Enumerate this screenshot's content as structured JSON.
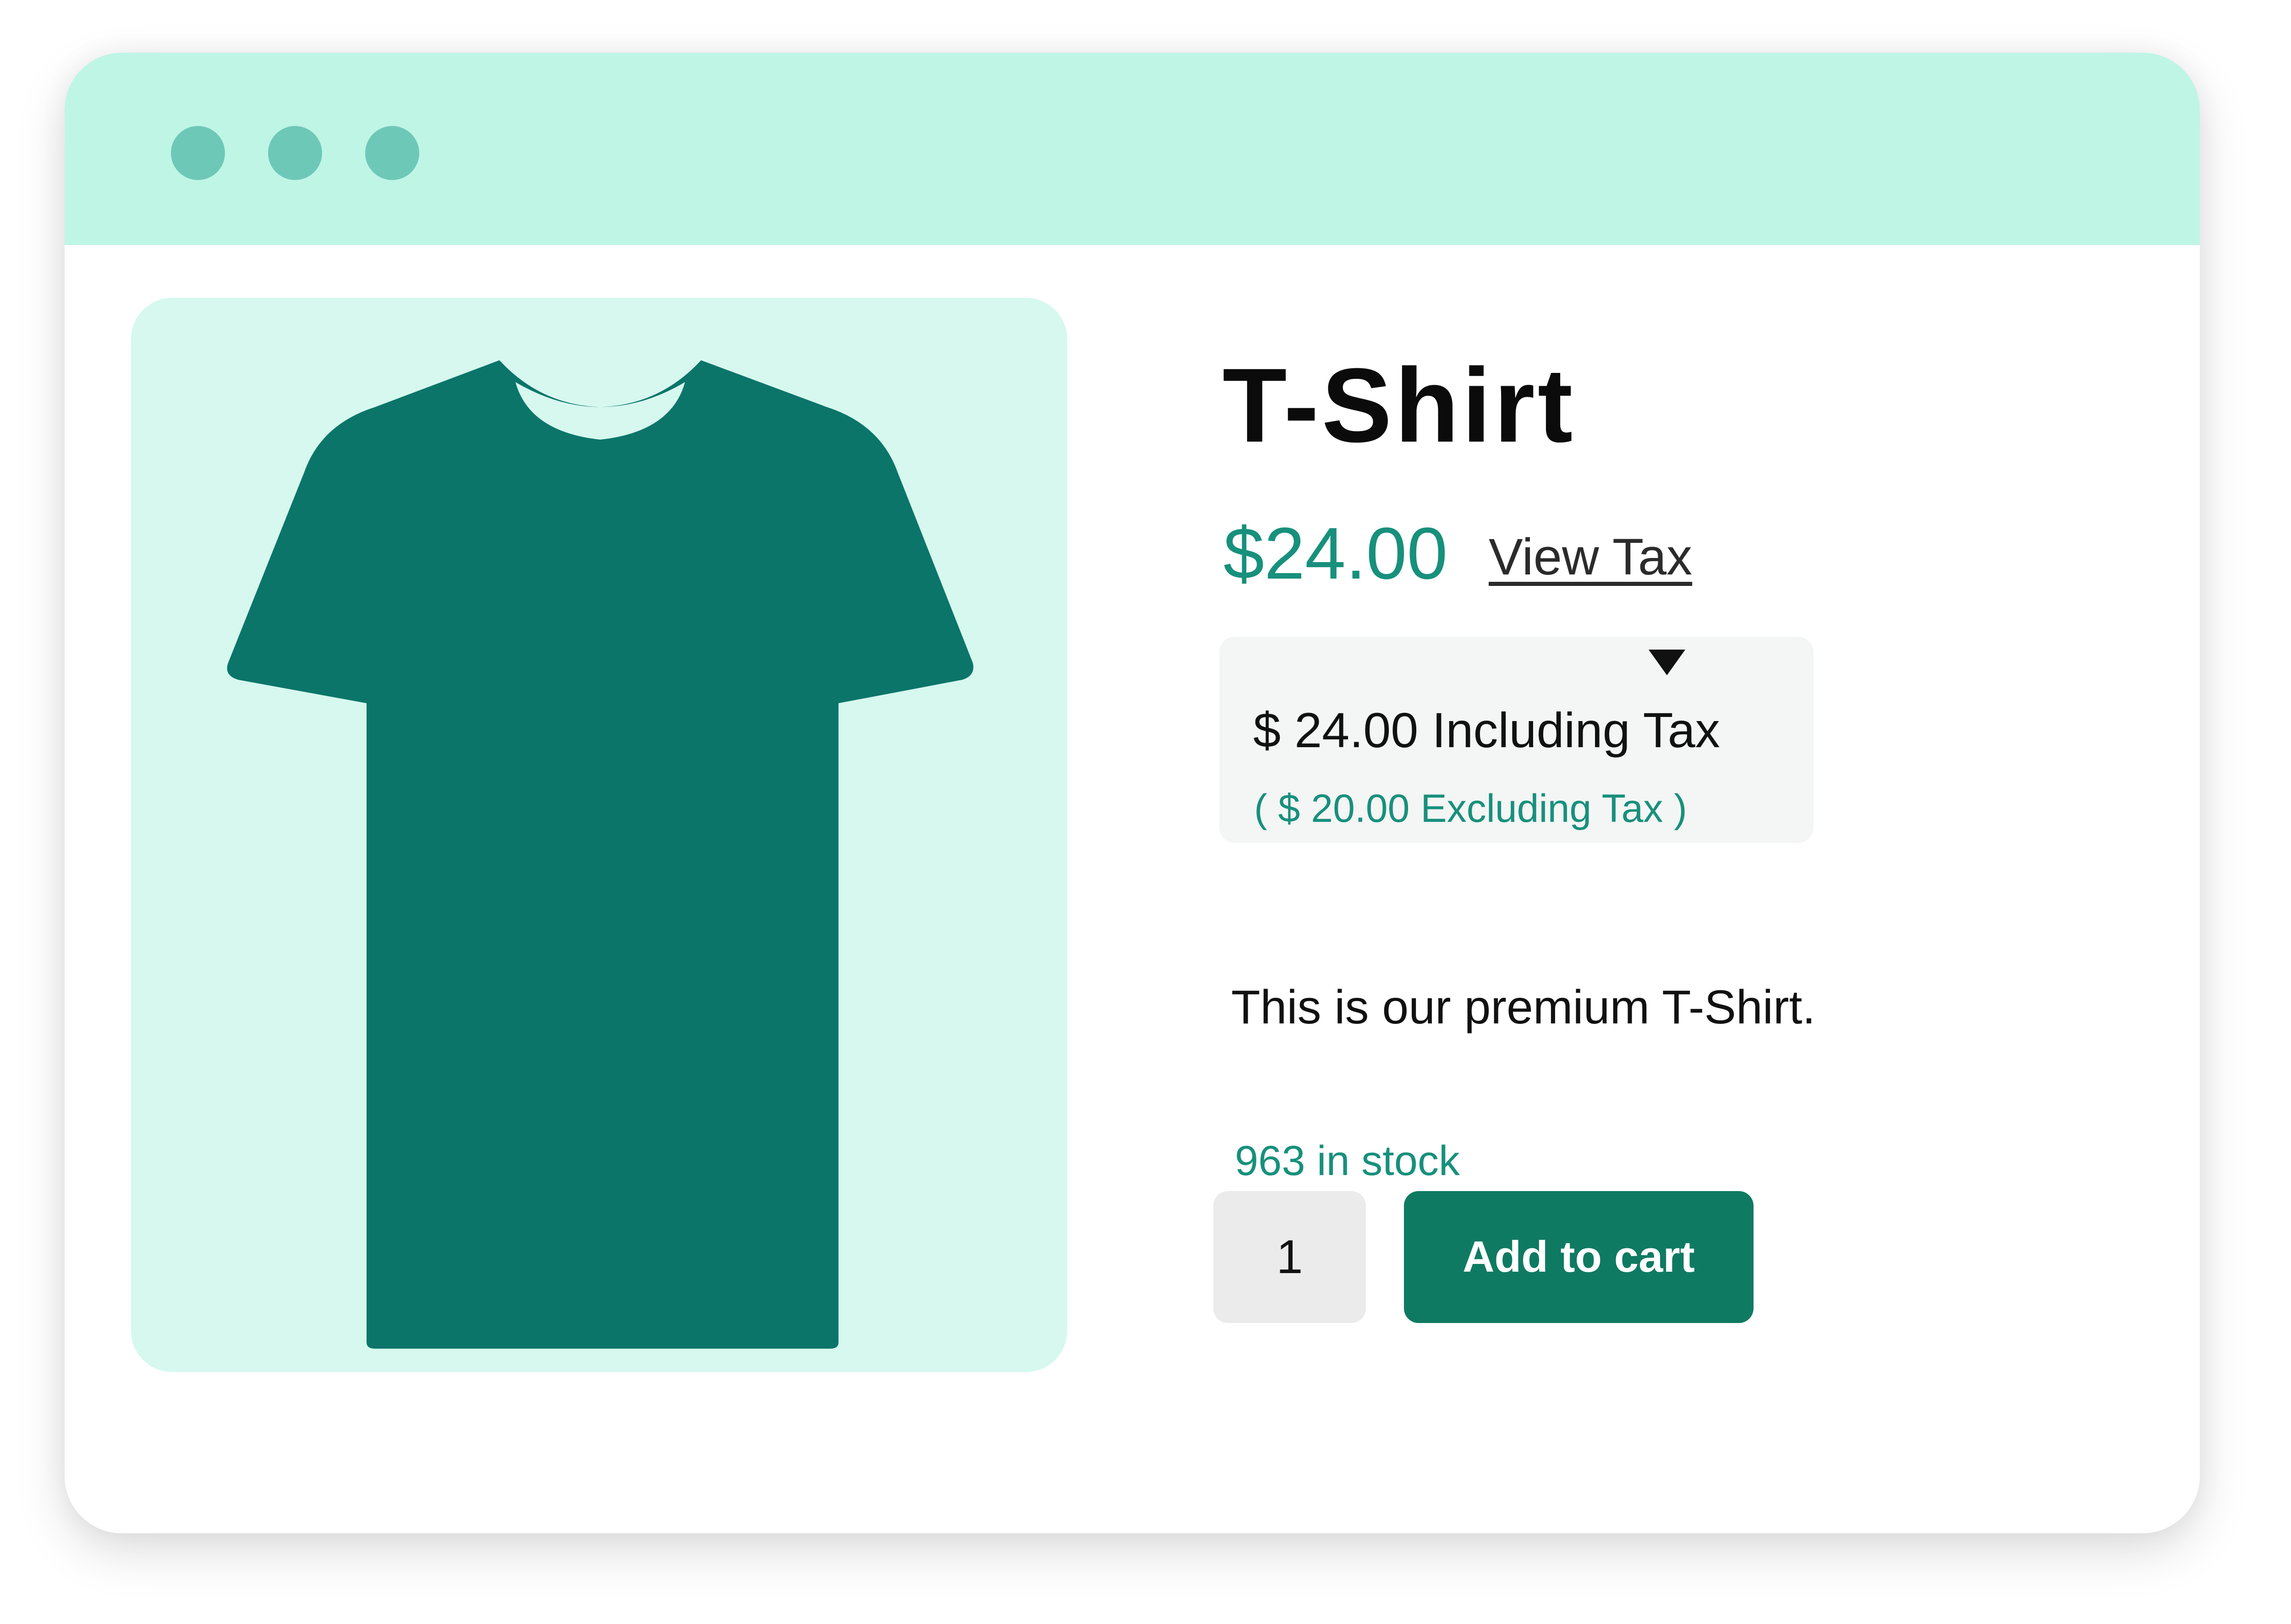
{
  "window": {
    "traffic_lights": [
      "window-dot",
      "window-dot",
      "window-dot"
    ]
  },
  "product": {
    "image_icon": "t-shirt-icon",
    "title": "T-Shirt",
    "price": "$24.00",
    "view_tax_label": "View Tax",
    "tax": {
      "including": "$ 24.00 Including Tax",
      "excluding": "( $ 20.00 Excluding Tax )"
    },
    "description": "This is our premium T-Shirt.",
    "stock": "963 in stock",
    "quantity": "1",
    "add_to_cart_label": "Add to cart"
  },
  "colors": {
    "titlebar": "#bff5e5",
    "dots": "#6ec8b8",
    "image_background": "#d6f8ee",
    "shirt": "#0b756a",
    "accent": "#17907c",
    "button": "#0f7a62",
    "tax_box": "#f4f5f5",
    "quantity_box": "#ebebeb"
  }
}
